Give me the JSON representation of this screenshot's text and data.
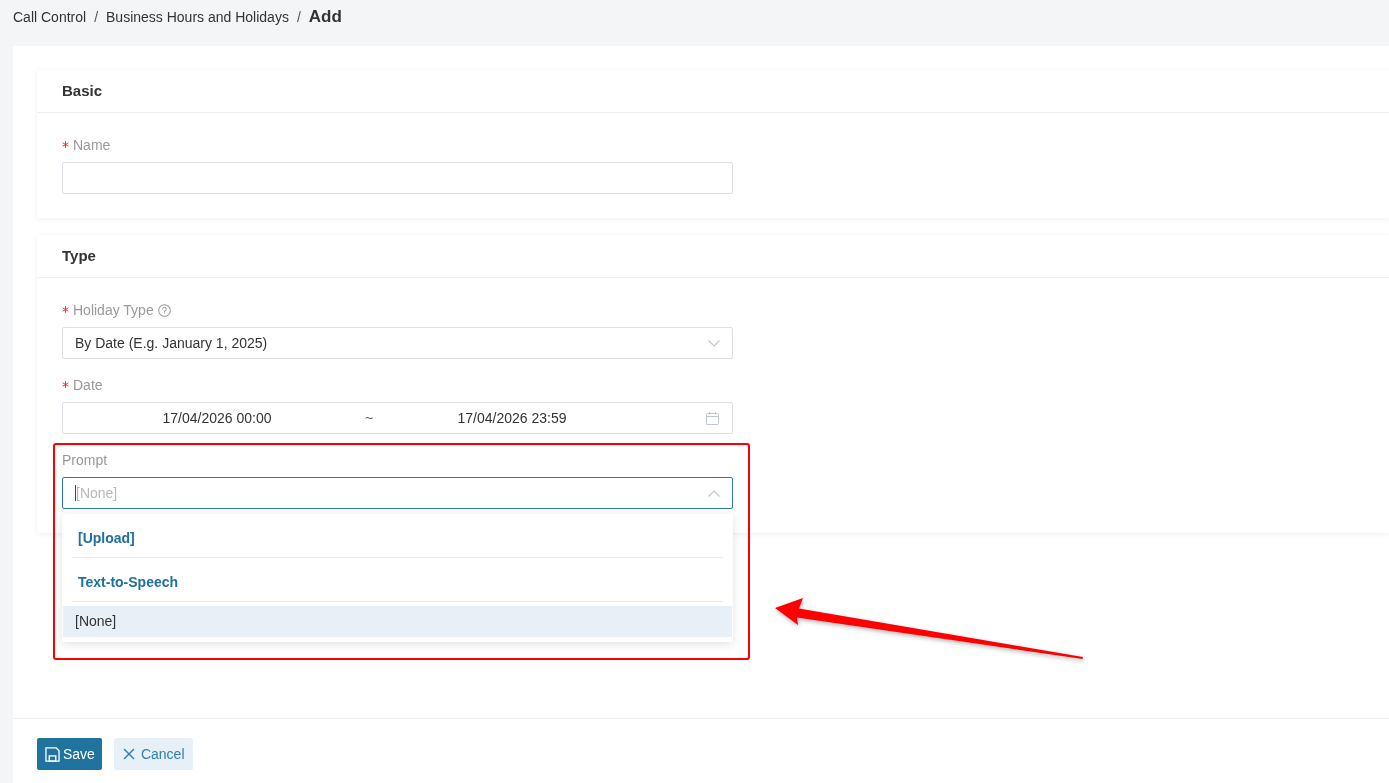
{
  "breadcrumb": [
    {
      "kind": "link",
      "label": "Call Control"
    },
    {
      "kind": "separator",
      "label": "/"
    },
    {
      "kind": "link",
      "label": "Business Hours and Holidays"
    },
    {
      "kind": "separator",
      "label": "/"
    },
    {
      "kind": "current",
      "label": "Add"
    }
  ],
  "sections": [
    {
      "title": "Basic",
      "fields": [
        {
          "kind": "text",
          "label": "Name",
          "required": true
        }
      ]
    },
    {
      "title": "Type",
      "fields": [
        {
          "kind": "select",
          "label": "Holiday Type",
          "required": true,
          "help": true,
          "value": "By Date (E.g. January 1, 2025)",
          "expanded": false,
          "focused": false
        },
        {
          "kind": "date_range",
          "label": "Date",
          "required": true,
          "start": "17/04/2026 00:00",
          "separator": "~",
          "end": "17/04/2026 23:59"
        },
        {
          "kind": "select",
          "label": "Prompt",
          "required": false,
          "placeholder": "[None]",
          "expanded": true,
          "focused": true,
          "options": [
            {
              "kind": "action",
              "label": "[Upload]",
              "selected": false
            },
            {
              "kind": "action",
              "label": "Text-to-Speech",
              "selected": false
            },
            {
              "kind": "option",
              "label": "[None]",
              "selected": true
            }
          ]
        }
      ]
    }
  ],
  "buttons": [
    {
      "kind": "primary",
      "label": "Save"
    },
    {
      "kind": "secondary",
      "label": "Cancel"
    }
  ],
  "annotation": {
    "frame": true,
    "arrow": true
  }
}
